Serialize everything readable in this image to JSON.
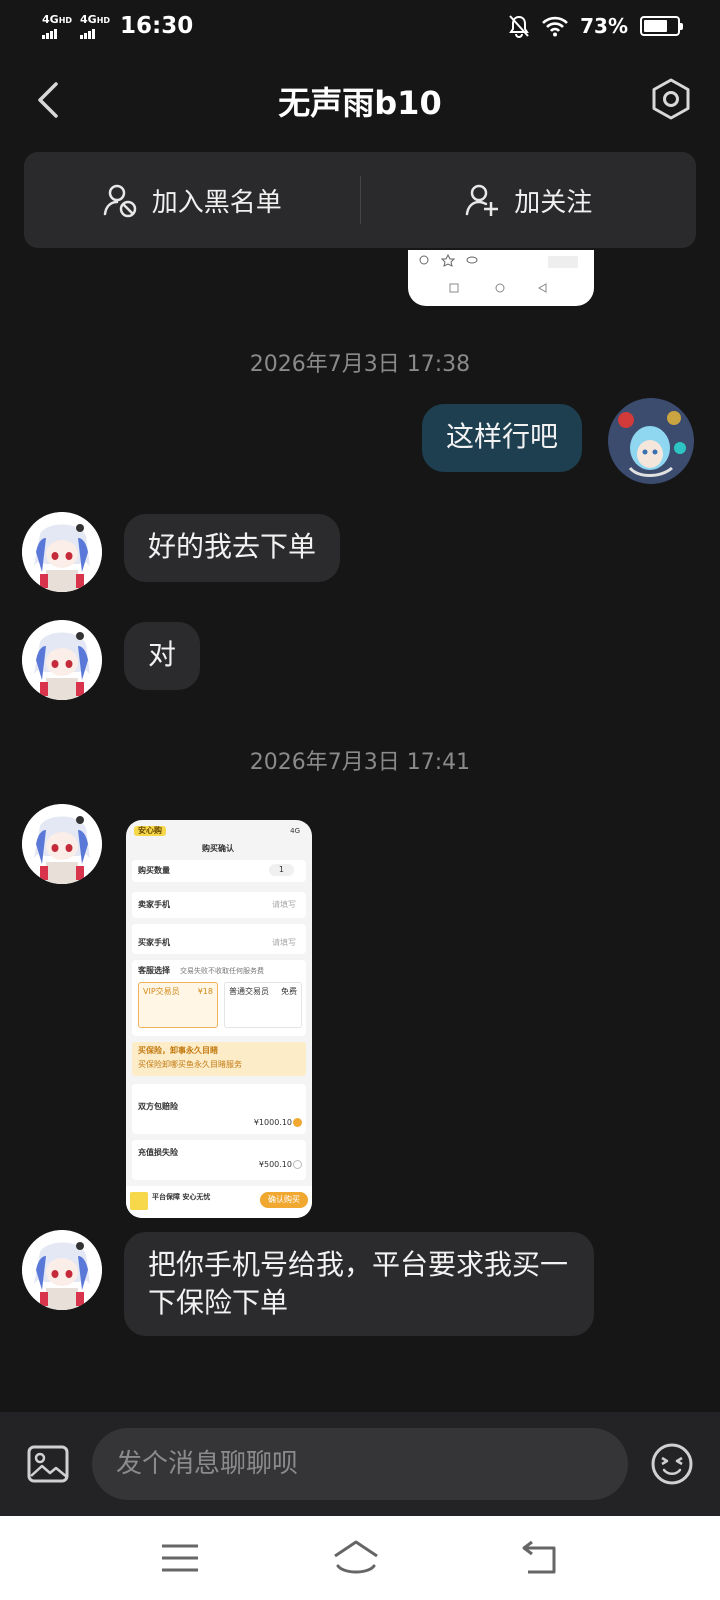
{
  "status_bar": {
    "network_1": "4G",
    "network_1_hd": "HD",
    "network_2": "4G",
    "network_2_hd": "HD",
    "time": "16:30",
    "battery_percent": "73%",
    "battery_level": 0.73
  },
  "header": {
    "title": "无声雨b10"
  },
  "actions": {
    "blacklist_label": "加入黑名单",
    "follow_label": "加关注"
  },
  "chat": {
    "timestamp_1": "2026年7月3日 17:38",
    "timestamp_2": "2026年7月3日 17:41",
    "messages": [
      {
        "text": "这样行吧"
      },
      {
        "text": "好的我去下单"
      },
      {
        "text": "对"
      },
      {
        "text": "把你手机号给我，平台要求我买一下保险下单"
      }
    ],
    "image_message": {
      "badge": "安心购",
      "signal": "4G",
      "page_title": "购买确认",
      "quantity_label": "购买数量",
      "quantity_value": "1",
      "seller_phone_label": "卖家手机",
      "seller_phone_placeholder": "请填写",
      "buyer_phone_label": "买家手机",
      "buyer_phone_placeholder": "请填写",
      "service_label": "客服选择",
      "service_note": "交易失败不收取任何服务费",
      "vip_label": "VIP交易员",
      "vip_price": "¥18",
      "normal_label": "普通交易员",
      "normal_price": "免费",
      "promo_1": "买保险，卸事永久目睹",
      "promo_2": "买保险卸哪买鱼永久目睹服务",
      "insurance_title": "双方包赔险",
      "insurance_price": "¥1000.10",
      "insurance_2_title": "充值损失险",
      "insurance_2_price": "¥500.10",
      "bottom_label": "平台保障 安心无忧",
      "confirm_button": "确认购买"
    }
  },
  "input_bar": {
    "placeholder": "发个消息聊聊呗"
  }
}
